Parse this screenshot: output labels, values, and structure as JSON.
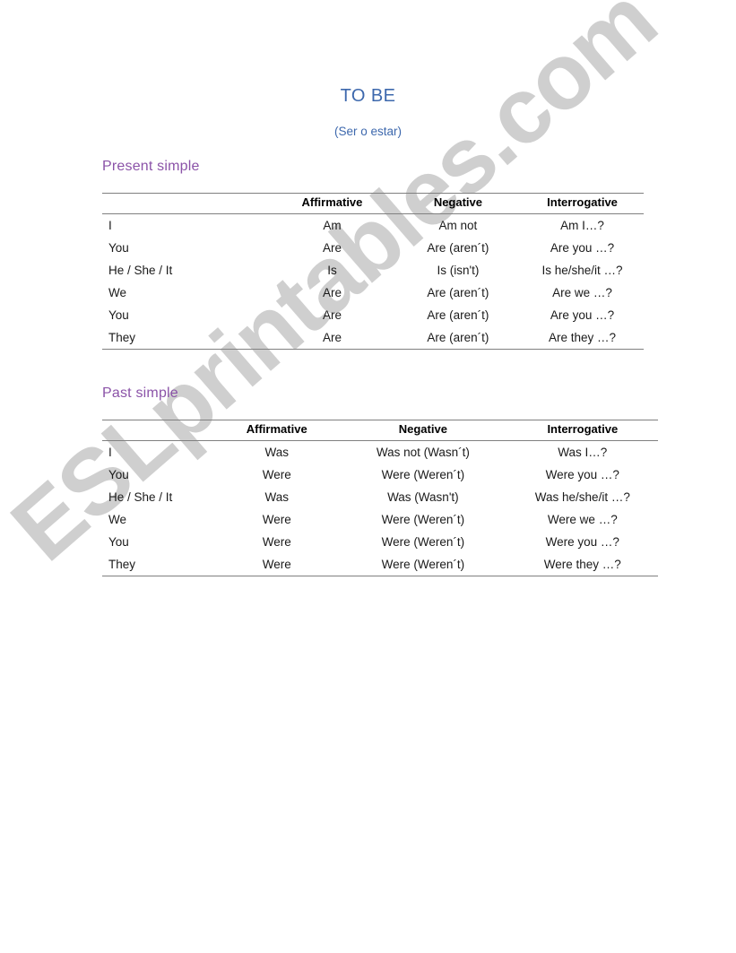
{
  "document": {
    "title": "TO BE",
    "subtitle": "(Ser o estar)"
  },
  "watermark": {
    "text": "ESLprintables.com"
  },
  "sections": [
    {
      "heading": "Present simple",
      "table": {
        "headers": [
          "",
          "Affirmative",
          "Negative",
          "Interrogative"
        ],
        "rows": [
          [
            "I",
            "Am",
            "Am not",
            "Am I…?"
          ],
          [
            "You",
            "Are",
            "Are (aren´t)",
            "Are you …?"
          ],
          [
            "He / She / It",
            "Is",
            "Is (isn't)",
            "Is he/she/it …?"
          ],
          [
            "We",
            "Are",
            "Are (aren´t)",
            "Are we …?"
          ],
          [
            "You",
            "Are",
            "Are (aren´t)",
            "Are you …?"
          ],
          [
            "They",
            "Are",
            "Are (aren´t)",
            "Are they …?"
          ]
        ]
      }
    },
    {
      "heading": "Past simple",
      "table": {
        "headers": [
          "",
          "Affirmative",
          "Negative",
          "Interrogative"
        ],
        "rows": [
          [
            "I",
            "Was",
            "Was not (Wasn´t)",
            "Was I…?"
          ],
          [
            "You",
            "Were",
            "Were (Weren´t)",
            "Were you …?"
          ],
          [
            "He / She / It",
            "Was",
            "Was (Wasn't)",
            "Was he/she/it …?"
          ],
          [
            "We",
            "Were",
            "Were (Weren´t)",
            "Were we …?"
          ],
          [
            "You",
            "Were",
            "Were (Weren´t)",
            "Were you …?"
          ],
          [
            "They",
            "Were",
            "Were (Weren´t)",
            "Were they …?"
          ]
        ]
      }
    }
  ],
  "colors": {
    "title_blue": "#3d68ad",
    "heading_purple": "#8b53a8",
    "rule_gray": "#808080",
    "watermark_gray": "#cfcfcf"
  }
}
